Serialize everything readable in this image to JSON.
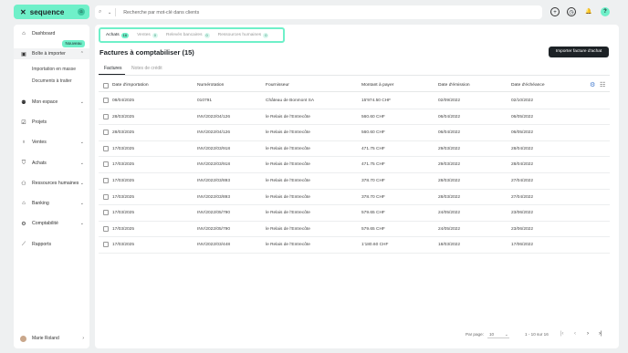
{
  "brand": {
    "name": "sequence",
    "mark": "✕",
    "badge": "G"
  },
  "search": {
    "placeholder": "Recherche par mot-clé dans clients"
  },
  "header_icons": [
    "plus-circle-icon",
    "clock-icon",
    "bell-icon",
    "help-icon"
  ],
  "sidebar": {
    "items": [
      {
        "label": "Dashboard",
        "icon": "home-icon"
      },
      {
        "label": "Boîte à importer",
        "icon": "inbox-icon",
        "badge": "Nouveau"
      },
      {
        "label": "Mon espace",
        "icon": "user-icon"
      },
      {
        "label": "Projets",
        "icon": "checkbox-icon"
      },
      {
        "label": "Ventes",
        "icon": "money-bag-icon"
      },
      {
        "label": "Achats",
        "icon": "cart-icon"
      },
      {
        "label": "Ressources humaines",
        "icon": "people-icon"
      },
      {
        "label": "Banking",
        "icon": "bank-icon"
      },
      {
        "label": "Comptabilité",
        "icon": "gear-icon"
      },
      {
        "label": "Rapports",
        "icon": "chart-icon"
      }
    ],
    "subitems": [
      "Importation en masse",
      "Documents à traiter"
    ],
    "user": {
      "name": "Marie Roland"
    }
  },
  "main": {
    "category_tabs": [
      {
        "label": "Achats",
        "count": "16"
      },
      {
        "label": "Ventes",
        "count": "0"
      },
      {
        "label": "Relevés bancaires",
        "count": "0"
      },
      {
        "label": "Ressources humaines",
        "count": "0"
      }
    ],
    "title": "Factures à comptabiliser (15)",
    "import_button": "Importer facture d'achat",
    "subtabs": [
      "Factures",
      "Notes de crédit"
    ],
    "columns": [
      "Date d'importation",
      "Numérotation",
      "Fournisseur",
      "Montant à payer",
      "Date d'émission",
      "Date d'échéance"
    ],
    "rows": [
      [
        "08/04/2025",
        "010791",
        "Château de Bonmont SA",
        "15'974.50 CHF",
        "02/09/2022",
        "02/10/2022"
      ],
      [
        "28/03/2025",
        "INV/2022/04/126",
        "le Relais de l'Entrecôte",
        "560.60 CHF",
        "06/04/2022",
        "06/05/2022"
      ],
      [
        "28/03/2025",
        "INV/2022/04/126",
        "le Relais de l'Entrecôte",
        "560.60 CHF",
        "06/04/2022",
        "06/05/2022"
      ],
      [
        "17/03/2025",
        "INV/2022/03/918",
        "le Relais de l'Entrecôte",
        "471.75 CHF",
        "29/03/2022",
        "28/04/2022"
      ],
      [
        "17/03/2025",
        "INV/2022/03/918",
        "le Relais de l'Entrecôte",
        "471.75 CHF",
        "29/03/2022",
        "28/04/2022"
      ],
      [
        "17/03/2025",
        "INV/2022/03/893",
        "le Relais de l'Entrecôte",
        "378.70 CHF",
        "28/03/2022",
        "27/04/2022"
      ],
      [
        "17/03/2025",
        "INV/2022/03/893",
        "le Relais de l'Entrecôte",
        "378.70 CHF",
        "28/03/2022",
        "27/04/2022"
      ],
      [
        "17/03/2025",
        "INV/2022/05/790",
        "le Relais de l'Entrecôte",
        "579.65 CHF",
        "24/05/2022",
        "23/06/2022"
      ],
      [
        "17/03/2025",
        "INV/2022/05/790",
        "le Relais de l'Entrecôte",
        "579.65 CHF",
        "24/05/2022",
        "23/06/2022"
      ],
      [
        "17/03/2025",
        "INV/2022/03/448",
        "le Relais de l'Entrecôte",
        "1'180.60 CHF",
        "18/03/2022",
        "17/06/2022"
      ]
    ],
    "pagination": {
      "per_page_label": "Par page:",
      "per_page": "10",
      "range": "1 - 10 sur 16"
    }
  },
  "colors": {
    "accent": "#6ff0c9",
    "dark": "#1d2226",
    "background": "#eef0f1"
  }
}
